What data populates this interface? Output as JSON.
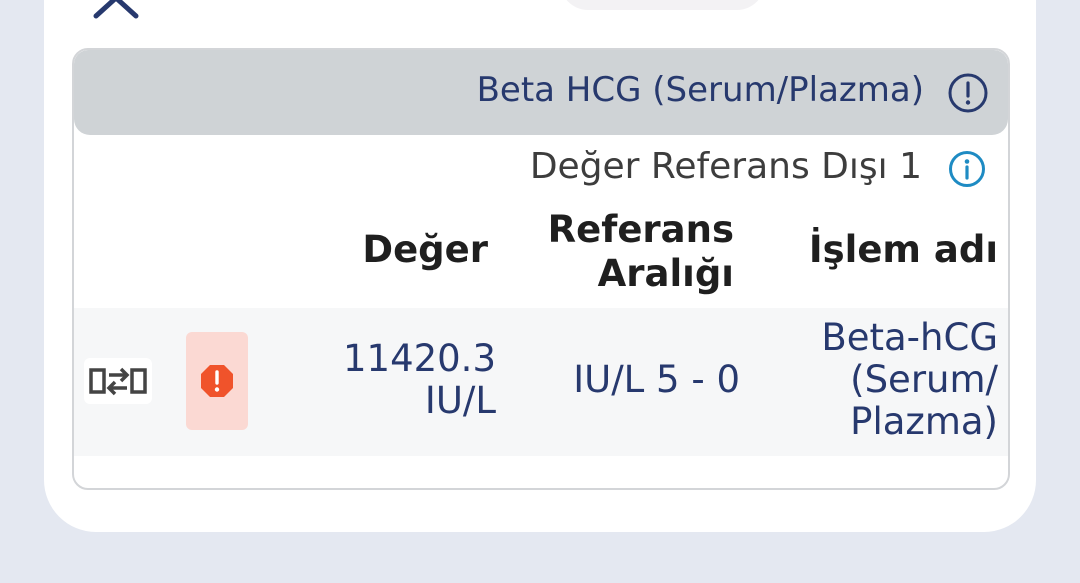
{
  "card": {
    "title": "Beta HCG (Serum/Plazma)",
    "out_of_range_text": "Değer Referans Dışı 1"
  },
  "table": {
    "headers": {
      "value": "Değer",
      "reference_line1": "Referans",
      "reference_line2": "Aralığı",
      "test_name": "İşlem adı"
    },
    "rows": [
      {
        "value_line1": "11420.3",
        "value_line2": "IU/L",
        "reference": "IU/L 5 - 0",
        "name_line1": "Beta-hCG",
        "name_line2": "(Serum/",
        "name_line3": "Plazma)"
      }
    ]
  },
  "icons": {
    "close": "close-icon",
    "alert": "alert-circle-icon",
    "info": "info-icon",
    "swap": "swap-icon",
    "warning": "warning-octagon-icon"
  },
  "colors": {
    "accent_text": "#27396e",
    "header_bg": "#cfd3d6",
    "info_blue": "#1e8bc3",
    "warning_orange": "#f0532b",
    "warning_bg": "#fbd9d3",
    "page_bg": "#e4e8f1"
  }
}
